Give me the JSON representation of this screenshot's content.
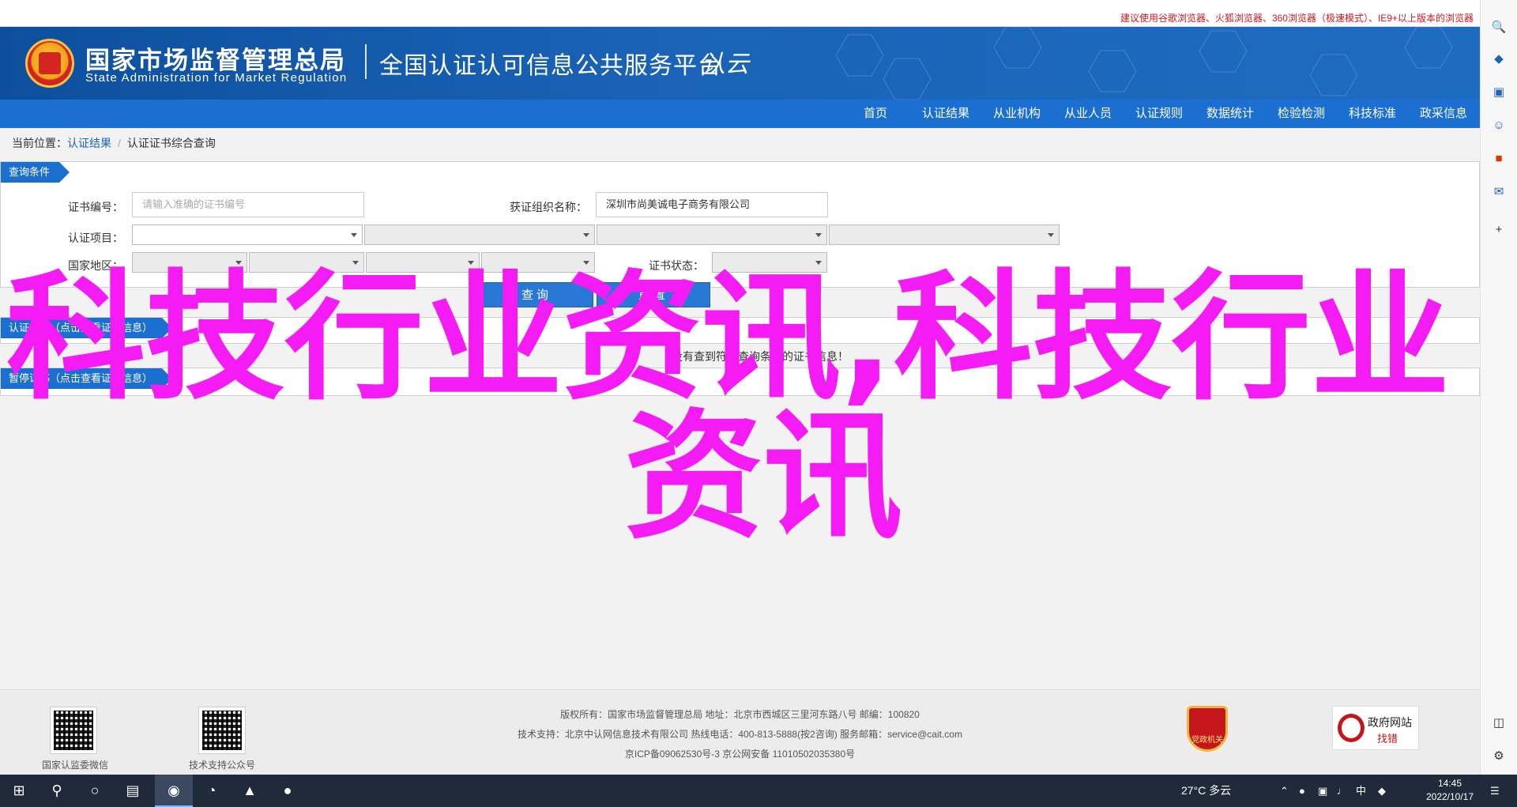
{
  "top_notice": "建议使用谷歌浏览器、火狐浏览器、360浏览器（极速模式）、IE9+以上版本的浏览器",
  "header": {
    "org_cn": "国家市场监督管理总局",
    "org_en": "State Administration  for  Market Regulation",
    "platform_title": "全国认证认可信息公共服务平台",
    "platform_logo": "认云"
  },
  "nav": {
    "items": [
      {
        "label": "首页"
      },
      {
        "label": "认证结果"
      },
      {
        "label": "从业机构"
      },
      {
        "label": "从业人员"
      },
      {
        "label": "认证规则"
      },
      {
        "label": "数据统计"
      },
      {
        "label": "检验检测"
      },
      {
        "label": "科技标准"
      },
      {
        "label": "政采信息"
      }
    ]
  },
  "breadcrumb": {
    "prefix": "当前位置：",
    "link": "认证结果",
    "current": "认证证书综合查询"
  },
  "query_panel": {
    "title": "查询条件",
    "cert_no_label": "证书编号：",
    "cert_no_placeholder": "请输入准确的证书编号",
    "org_name_label": "获证组织名称：",
    "org_name_value": "深圳市尚美诚电子商务有限公司",
    "cert_project_label": "认证项目：",
    "region_label": "国家地区：",
    "status_label": "证书状态：",
    "query_button": "查询",
    "reset_button": "重置"
  },
  "result_panel": {
    "title": "认证证书（点击查看证书信息）",
    "empty_message": "没有查到符合查询条件的证书信息！"
  },
  "suspend_panel": {
    "title": "暂停证书（点击查看证书信息）"
  },
  "overlay_text": {
    "line1": "科技行业资讯,科技行业",
    "line2": "资讯"
  },
  "footer": {
    "qr1_caption": "国家认监委微信",
    "qr2_caption": "技术支持公众号",
    "line1": "版权所有：国家市场监督管理总局    地址：北京市西城区三里河东路八号    邮编：100820",
    "line2": "技术支持：北京中认网信息技术有限公司    热线电话：400-813-5888(按2咨询)    服务邮箱：service@cait.com",
    "line3": "京ICP备09062530号-3    京公网安备  11010502035380号",
    "party_badge": "党政机关",
    "gov_badge_title": "政府网站",
    "gov_badge_sub": "找错"
  },
  "taskbar": {
    "weather": "27°C  多云",
    "ime": "中",
    "time": "14:45",
    "date": "2022/10/17"
  }
}
